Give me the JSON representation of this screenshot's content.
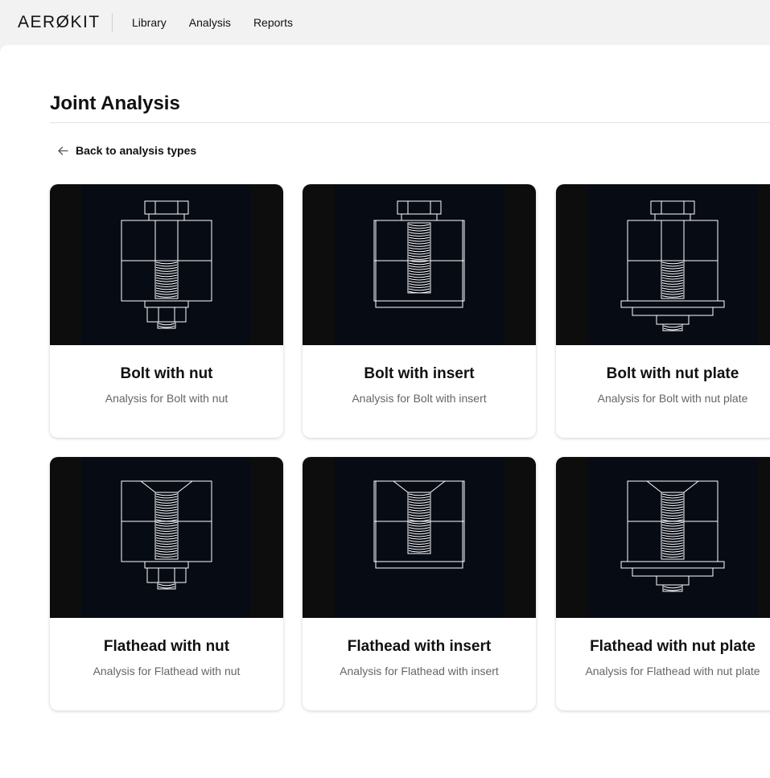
{
  "brand": {
    "logo": "AERØKIT"
  },
  "nav": [
    {
      "label": "Library"
    },
    {
      "label": "Analysis"
    },
    {
      "label": "Reports"
    }
  ],
  "page": {
    "title": "Joint Analysis",
    "back_label": "Back to analysis types"
  },
  "cards": [
    {
      "title": "Bolt with nut",
      "description": "Analysis for Bolt with nut",
      "head": "hex",
      "bottom": "nut"
    },
    {
      "title": "Bolt with insert",
      "description": "Analysis for Bolt with insert",
      "head": "hex",
      "bottom": "insert"
    },
    {
      "title": "Bolt with nut plate",
      "description": "Analysis for Bolt with nut plate",
      "head": "hex",
      "bottom": "nutplate"
    },
    {
      "title": "Flathead with nut",
      "description": "Analysis for Flathead with nut",
      "head": "flat",
      "bottom": "nut"
    },
    {
      "title": "Flathead with insert",
      "description": "Analysis for Flathead with insert",
      "head": "flat",
      "bottom": "insert"
    },
    {
      "title": "Flathead with nut plate",
      "description": "Analysis for Flathead with nut plate",
      "head": "flat",
      "bottom": "nutplate"
    }
  ],
  "colors": {
    "image_bg": "#0d0d0d",
    "image_inner": "#070b14",
    "line": "#ffffff"
  }
}
